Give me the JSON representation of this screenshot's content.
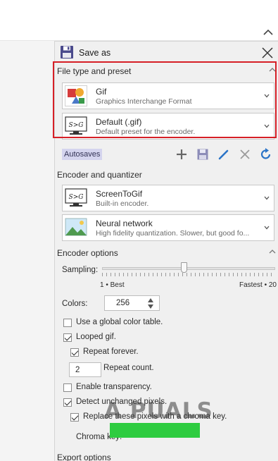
{
  "window": {
    "title": "Save as"
  },
  "file_type_section": {
    "title": "File type and preset",
    "type": {
      "title": "Gif",
      "subtitle": "Graphics Interchange Format"
    },
    "preset": {
      "title": "Default (.gif)",
      "subtitle": "Default preset for the encoder.",
      "thumb_text": "S>G"
    }
  },
  "toolbar": {
    "autosaves_label": "Autosaves"
  },
  "encoder_section": {
    "title": "Encoder and quantizer",
    "encoder": {
      "title": "ScreenToGif",
      "subtitle": "Built-in encoder.",
      "thumb_text": "S>G"
    },
    "quantizer": {
      "title": "Neural network",
      "subtitle": "High fidelity quantization. Slower, but good fo..."
    }
  },
  "encoder_options": {
    "title": "Encoder options",
    "sampling_label": "Sampling:",
    "sampling_min_label": "1 • Best",
    "sampling_max_label": "Fastest • 20",
    "sampling_value_fraction": 0.47,
    "colors_label": "Colors:",
    "colors_value": "256",
    "global_color_table_label": "Use a global color table.",
    "global_color_table_checked": false,
    "looped_gif_label": "Looped gif.",
    "looped_gif_checked": true,
    "repeat_forever_label": "Repeat forever.",
    "repeat_forever_checked": true,
    "repeat_count_value": "2",
    "repeat_count_label": "Repeat count.",
    "transparency_label": "Enable transparency.",
    "transparency_checked": false,
    "detect_unchanged_label": "Detect unchanged pixels.",
    "detect_unchanged_checked": true,
    "replace_chroma_label": "Replace these pixels with a chroma key.",
    "replace_chroma_checked": true,
    "chroma_key_label": "Chroma key:",
    "chroma_key_color": "#2ecc40"
  },
  "export_section": {
    "title": "Export options"
  },
  "watermark": "A PUALS",
  "colors": {
    "highlight": "#d61f26",
    "accent_blue": "#2b74c7",
    "autosaves_bg": "#d4d4ee"
  }
}
